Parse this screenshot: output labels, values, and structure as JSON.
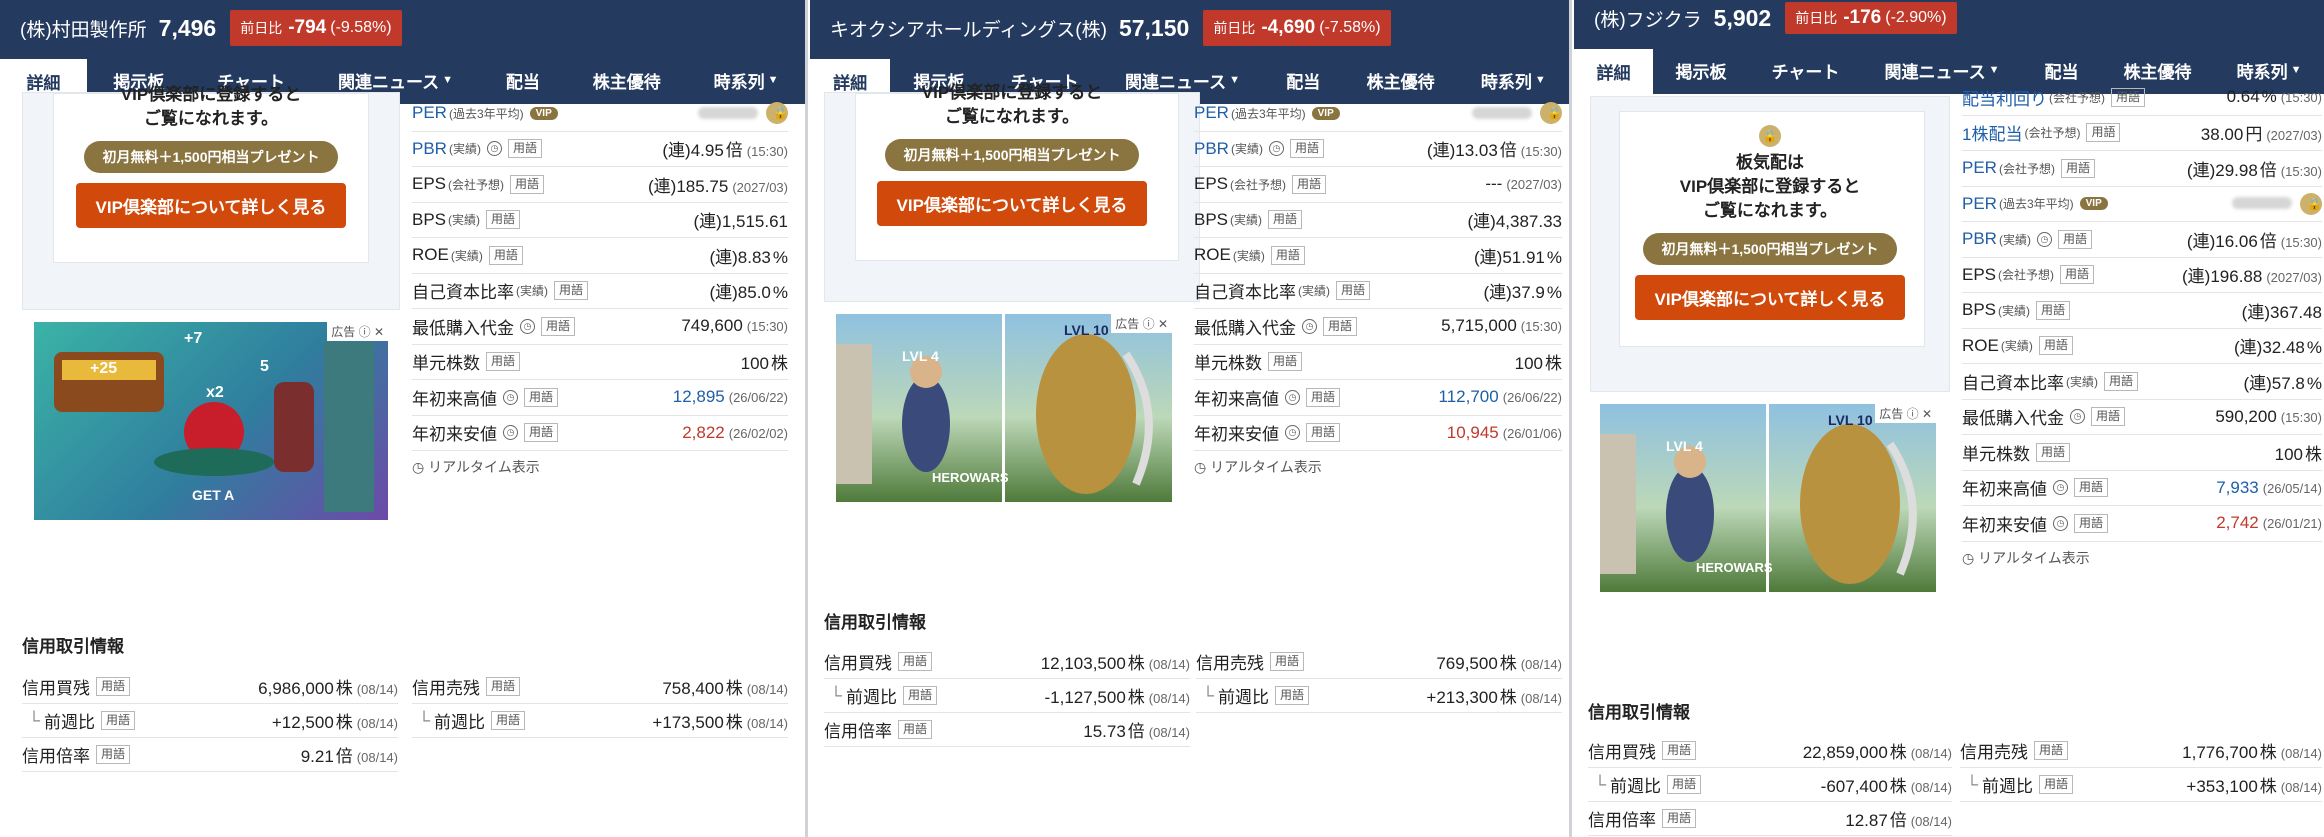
{
  "panels": [
    {
      "company": "(株)村田製作所",
      "price": "7,496",
      "change_label": "前日比",
      "change": "-794",
      "change_pct": "(-9.58%)",
      "tabs": [
        "詳細",
        "掲示板",
        "チャート",
        "関連ニュース",
        "配当",
        "株主優待",
        "時系列"
      ],
      "vip": {
        "message": [
          "VIP倶楽部に登録すると",
          "ご覧になれます。"
        ],
        "promo": "初月無料＋1,500円相当プレゼント",
        "button": "VIP倶楽部について詳しく見る"
      },
      "ad": {
        "label": "広告",
        "texts": [
          "+7",
          "+25",
          "x2",
          "5",
          "GET A"
        ]
      },
      "metrics": [
        {
          "label": "PER",
          "sub": "(過去3年平均)",
          "vip": "VIP",
          "locked": true
        },
        {
          "label": "PBR",
          "sub": "(実績)",
          "clock": true,
          "tag": "用語",
          "prefix": "(連)",
          "value": "4.95",
          "unit": "倍",
          "date": "(15:30)"
        },
        {
          "label": "EPS",
          "sub": "(会社予想)",
          "tag": "用語",
          "prefix": "(連)",
          "value": "185.75",
          "unit": "",
          "date": "(2027/03)"
        },
        {
          "label": "BPS",
          "sub": "(実績)",
          "tag": "用語",
          "prefix": "(連)",
          "value": "1,515.61",
          "unit": "",
          "date": ""
        },
        {
          "label": "ROE",
          "sub": "(実績)",
          "tag": "用語",
          "prefix": "(連)",
          "value": "8.83",
          "unit": "%",
          "date": ""
        },
        {
          "label": "自己資本比率",
          "sub": "(実績)",
          "tag": "用語",
          "prefix": "(連)",
          "value": "85.0",
          "unit": "%",
          "date": ""
        },
        {
          "label": "最低購入代金",
          "clock": true,
          "tag": "用語",
          "prefix": "",
          "value": "749,600",
          "unit": "",
          "date": "(15:30)"
        },
        {
          "label": "単元株数",
          "tag": "用語",
          "prefix": "",
          "value": "100",
          "unit": "株",
          "date": ""
        },
        {
          "label": "年初来高値",
          "clock": true,
          "tag": "用語",
          "prefix": "",
          "value": "12,895",
          "unit": "",
          "date": "(26/06/22)",
          "color": "blue"
        },
        {
          "label": "年初来安値",
          "clock": true,
          "tag": "用語",
          "prefix": "",
          "value": "2,822",
          "unit": "",
          "date": "(26/02/02)",
          "color": "red"
        }
      ],
      "realtime": "リアルタイム表示",
      "margin_title": "信用取引情報",
      "margin_left": [
        {
          "label": "信用買残",
          "tag": "用語",
          "value": "6,986,000",
          "unit": "株",
          "date": "(08/14)"
        },
        {
          "label": "前週比",
          "tag": "用語",
          "value": "+12,500",
          "unit": "株",
          "date": "(08/14)",
          "indent": true
        },
        {
          "label": "信用倍率",
          "tag": "用語",
          "value": "9.21",
          "unit": "倍",
          "date": "(08/14)"
        }
      ],
      "margin_right": [
        {
          "label": "信用売残",
          "tag": "用語",
          "value": "758,400",
          "unit": "株",
          "date": "(08/14)"
        },
        {
          "label": "前週比",
          "tag": "用語",
          "value": "+173,500",
          "unit": "株",
          "date": "(08/14)",
          "indent": true
        }
      ]
    },
    {
      "company": "キオクシアホールディングス(株)",
      "price": "57,150",
      "change_label": "前日比",
      "change": "-4,690",
      "change_pct": "(-7.58%)",
      "tabs": [
        "詳細",
        "掲示板",
        "チャート",
        "関連ニュース",
        "配当",
        "株主優待",
        "時系列"
      ],
      "vip": {
        "message": [
          "VIP倶楽部に登録すると",
          "ご覧になれます。"
        ],
        "promo": "初月無料＋1,500円相当プレゼント",
        "button": "VIP倶楽部について詳しく見る"
      },
      "ad": {
        "label": "広告",
        "texts": [
          "LVL 4",
          "LVL 10",
          "HEROWARS"
        ]
      },
      "metrics": [
        {
          "label": "PER",
          "sub": "(過去3年平均)",
          "vip": "VIP",
          "locked": true
        },
        {
          "label": "PBR",
          "sub": "(実績)",
          "clock": true,
          "tag": "用語",
          "prefix": "(連)",
          "value": "13.03",
          "unit": "倍",
          "date": "(15:30)"
        },
        {
          "label": "EPS",
          "sub": "(会社予想)",
          "tag": "用語",
          "prefix": "",
          "value": "---",
          "unit": "",
          "date": "(2027/03)"
        },
        {
          "label": "BPS",
          "sub": "(実績)",
          "tag": "用語",
          "prefix": "(連)",
          "value": "4,387.33",
          "unit": "",
          "date": ""
        },
        {
          "label": "ROE",
          "sub": "(実績)",
          "tag": "用語",
          "prefix": "(連)",
          "value": "51.91",
          "unit": "%",
          "date": ""
        },
        {
          "label": "自己資本比率",
          "sub": "(実績)",
          "tag": "用語",
          "prefix": "(連)",
          "value": "37.9",
          "unit": "%",
          "date": ""
        },
        {
          "label": "最低購入代金",
          "clock": true,
          "tag": "用語",
          "prefix": "",
          "value": "5,715,000",
          "unit": "",
          "date": "(15:30)"
        },
        {
          "label": "単元株数",
          "tag": "用語",
          "prefix": "",
          "value": "100",
          "unit": "株",
          "date": ""
        },
        {
          "label": "年初来高値",
          "clock": true,
          "tag": "用語",
          "prefix": "",
          "value": "112,700",
          "unit": "",
          "date": "(26/06/22)",
          "color": "blue"
        },
        {
          "label": "年初来安値",
          "clock": true,
          "tag": "用語",
          "prefix": "",
          "value": "10,945",
          "unit": "",
          "date": "(26/01/06)",
          "color": "red"
        }
      ],
      "realtime": "リアルタイム表示",
      "margin_title": "信用取引情報",
      "margin_left": [
        {
          "label": "信用買残",
          "tag": "用語",
          "value": "12,103,500",
          "unit": "株",
          "date": "(08/14)"
        },
        {
          "label": "前週比",
          "tag": "用語",
          "value": "-1,127,500",
          "unit": "株",
          "date": "(08/14)",
          "indent": true
        },
        {
          "label": "信用倍率",
          "tag": "用語",
          "value": "15.73",
          "unit": "倍",
          "date": "(08/14)"
        }
      ],
      "margin_right": [
        {
          "label": "信用売残",
          "tag": "用語",
          "value": "769,500",
          "unit": "株",
          "date": "(08/14)"
        },
        {
          "label": "前週比",
          "tag": "用語",
          "value": "+213,300",
          "unit": "株",
          "date": "(08/14)",
          "indent": true
        }
      ]
    },
    {
      "company": "(株)フジクラ",
      "price": "5,902",
      "change_label": "前日比",
      "change": "-176",
      "change_pct": "(-2.90%)",
      "tabs": [
        "詳細",
        "掲示板",
        "チャート",
        "関連ニュース",
        "配当",
        "株主優待",
        "時系列"
      ],
      "vip": {
        "message": [
          "板気配は",
          "VIP倶楽部に登録すると",
          "ご覧になれます。"
        ],
        "promo": "初月無料＋1,500円相当プレゼント",
        "button": "VIP倶楽部について詳しく見る"
      },
      "ad": {
        "label": "広告",
        "texts": [
          "LVL 4",
          "LVL 10",
          "HEROWARS"
        ]
      },
      "metrics": [
        {
          "label": "配当利回り",
          "sub": "(会社予想)",
          "tag": "用語",
          "prefix": "",
          "value": "0.64",
          "unit": "%",
          "date": "(15:30)"
        },
        {
          "label": "1株配当",
          "sub": "(会社予想)",
          "tag": "用語",
          "prefix": "",
          "value": "38.00",
          "unit": "円",
          "date": "(2027/03)"
        },
        {
          "label": "PER",
          "sub": "(会社予想)",
          "tag": "用語",
          "prefix": "(連)",
          "value": "29.98",
          "unit": "倍",
          "date": "(15:30)"
        },
        {
          "label": "PER",
          "sub": "(過去3年平均)",
          "vip": "VIP",
          "locked": true
        },
        {
          "label": "PBR",
          "sub": "(実績)",
          "clock": true,
          "tag": "用語",
          "prefix": "(連)",
          "value": "16.06",
          "unit": "倍",
          "date": "(15:30)"
        },
        {
          "label": "EPS",
          "sub": "(会社予想)",
          "tag": "用語",
          "prefix": "(連)",
          "value": "196.88",
          "unit": "",
          "date": "(2027/03)"
        },
        {
          "label": "BPS",
          "sub": "(実績)",
          "tag": "用語",
          "prefix": "(連)",
          "value": "367.48",
          "unit": "",
          "date": ""
        },
        {
          "label": "ROE",
          "sub": "(実績)",
          "tag": "用語",
          "prefix": "(連)",
          "value": "32.48",
          "unit": "%",
          "date": ""
        },
        {
          "label": "自己資本比率",
          "sub": "(実績)",
          "tag": "用語",
          "prefix": "(連)",
          "value": "57.8",
          "unit": "%",
          "date": ""
        },
        {
          "label": "最低購入代金",
          "clock": true,
          "tag": "用語",
          "prefix": "",
          "value": "590,200",
          "unit": "",
          "date": "(15:30)"
        },
        {
          "label": "単元株数",
          "tag": "用語",
          "prefix": "",
          "value": "100",
          "unit": "株",
          "date": ""
        },
        {
          "label": "年初来高値",
          "clock": true,
          "tag": "用語",
          "prefix": "",
          "value": "7,933",
          "unit": "",
          "date": "(26/05/14)",
          "color": "blue"
        },
        {
          "label": "年初来安値",
          "clock": true,
          "tag": "用語",
          "prefix": "",
          "value": "2,742",
          "unit": "",
          "date": "(26/01/21)",
          "color": "red"
        }
      ],
      "realtime": "リアルタイム表示",
      "margin_title": "信用取引情報",
      "margin_left": [
        {
          "label": "信用買残",
          "tag": "用語",
          "value": "22,859,000",
          "unit": "株",
          "date": "(08/14)"
        },
        {
          "label": "前週比",
          "tag": "用語",
          "value": "-607,400",
          "unit": "株",
          "date": "(08/14)",
          "indent": true
        },
        {
          "label": "信用倍率",
          "tag": "用語",
          "value": "12.87",
          "unit": "倍",
          "date": "(08/14)"
        }
      ],
      "margin_right": [
        {
          "label": "信用売残",
          "tag": "用語",
          "value": "1,776,700",
          "unit": "株",
          "date": "(08/14)"
        },
        {
          "label": "前週比",
          "tag": "用語",
          "value": "+353,100",
          "unit": "株",
          "date": "(08/14)",
          "indent": true
        }
      ]
    }
  ],
  "icons": {
    "clock": "clock-icon",
    "lock": "lock-icon",
    "ad_info": "info-icon",
    "ad_close": "close-icon",
    "dropdown": "chevron-down-icon"
  },
  "colors": {
    "header": "#243a5e",
    "negative": "#c0392b",
    "link": "#1f5ea8",
    "vip_button": "#d14a0b",
    "promo": "#8a7440"
  }
}
